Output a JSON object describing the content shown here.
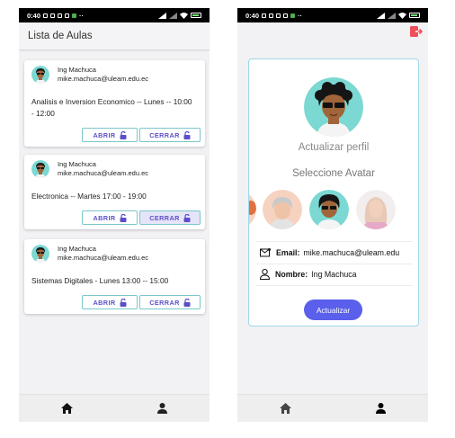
{
  "status_bar": {
    "time": "0:40",
    "dots": "··"
  },
  "left": {
    "title": "Lista de Aulas",
    "cards": [
      {
        "name": "Ing Machuca",
        "email": "mike.machuca@uleam.edu.ec",
        "course_line1": "Analisis e Inversion Economico -- Lunes -- 10:00",
        "course_line2": "- 12:00",
        "open": "ABRIR",
        "close": "CERRAR"
      },
      {
        "name": "Ing Machuca",
        "email": "mike.machuca@uleam.edu.ec",
        "course_line1": "Electronica -- Martes 17:00 - 19:00",
        "course_line2": "",
        "open": "ABRIR",
        "close": "CERRAR"
      },
      {
        "name": "Ing Machuca",
        "email": "mike.machuca@uleam.edu.ec",
        "course_line1": "Sistemas Digitales - Lunes 13:00 -- 15:00",
        "course_line2": "",
        "open": "ABRIR",
        "close": "CERRAR"
      }
    ],
    "nav": [
      "home-icon",
      "person-icon"
    ]
  },
  "right": {
    "update_profile": "Actualizar perfil",
    "select_avatar": "Seleccione Avatar",
    "email_label": "Email:",
    "email_value": "mike.machuca@uleam.edu",
    "name_label": "Nombre:",
    "name_value": "Ing Machuca",
    "update_button": "Actualizar",
    "nav": [
      "home-icon",
      "person-icon"
    ]
  },
  "colors": {
    "accent": "#5a5fec",
    "button_text": "#5b4fc7",
    "button_border": "#7ac7c9",
    "avatar_bg": "#7bd8d2"
  }
}
